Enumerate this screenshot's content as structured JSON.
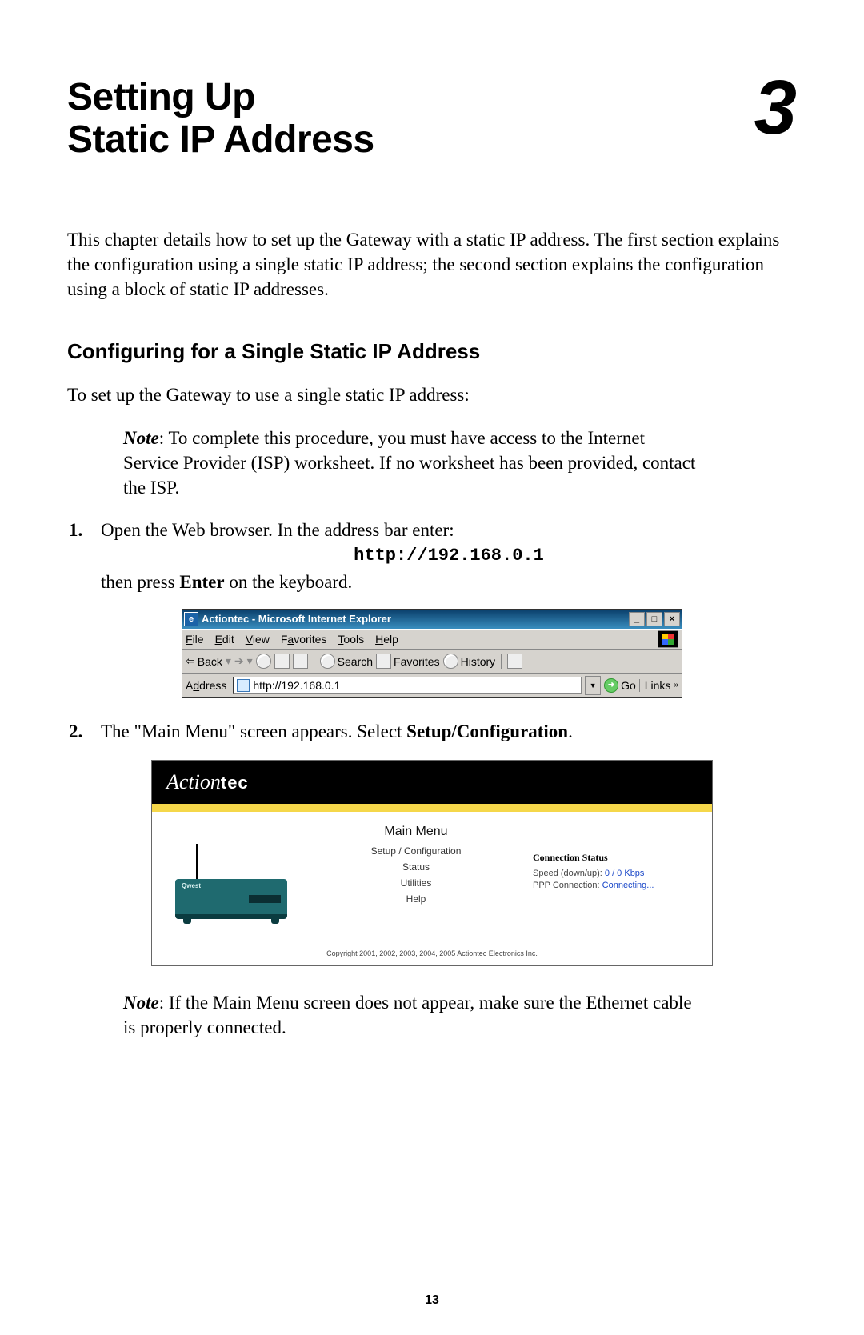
{
  "chapter": {
    "title_line1": "Setting Up",
    "title_line2": "Static IP Address",
    "number": "3"
  },
  "intro": "This chapter details how to set up the Gateway with a static IP address. The first section explains the configuration using a single static IP address; the second section explains the configuration using a block of static IP addresses.",
  "section": {
    "title_a": "Configuring for a Single Static ",
    "title_ip": "IP",
    "title_b": " Address",
    "lead": "To set up the Gateway to use a single static IP address:"
  },
  "note1": {
    "label": "Note",
    "text": ": To complete this procedure, you must have access to the Internet Service Provider (ISP) worksheet. If no worksheet has been provided, contact the ISP."
  },
  "step1": {
    "num": "1.",
    "a": "Open the Web browser. In the address bar enter:",
    "url": "http://192.168.0.1",
    "b1": "then press ",
    "b_bold": "Enter",
    "b2": " on the keyboard."
  },
  "ie": {
    "title": "Actiontec - Microsoft Internet Explorer",
    "menu": {
      "file": "File",
      "edit": "Edit",
      "view": "View",
      "favorites": "Favorites",
      "tools": "Tools",
      "help": "Help"
    },
    "toolbar": {
      "back": "Back",
      "search": "Search",
      "favorites": "Favorites",
      "history": "History"
    },
    "address_label": "Address",
    "address_value": "http://192.168.0.1",
    "go": "Go",
    "links": "Links"
  },
  "step2": {
    "num": "2.",
    "a": "The \"Main Menu\" screen appears. Select ",
    "bold": "Setup/Configuration",
    "b": "."
  },
  "actiontec": {
    "logo_script": "Action",
    "logo_tec": "tec",
    "main_menu": "Main Menu",
    "links": {
      "setup": "Setup / Configuration",
      "status": "Status",
      "utilities": "Utilities",
      "help": "Help"
    },
    "cs_title": "Connection Status",
    "speed_label": "Speed (down/up): ",
    "speed_value": "0 / 0 Kbps",
    "ppp_label": "PPP Connection: ",
    "ppp_value": "Connecting...",
    "router_brand": "Qwest",
    "copyright": "Copyright 2001, 2002, 2003, 2004, 2005 Actiontec Electronics Inc."
  },
  "note2": {
    "label": "Note",
    "text": ": If the Main Menu screen does not appear, make sure the Ethernet cable is properly connected."
  },
  "page_number": "13"
}
